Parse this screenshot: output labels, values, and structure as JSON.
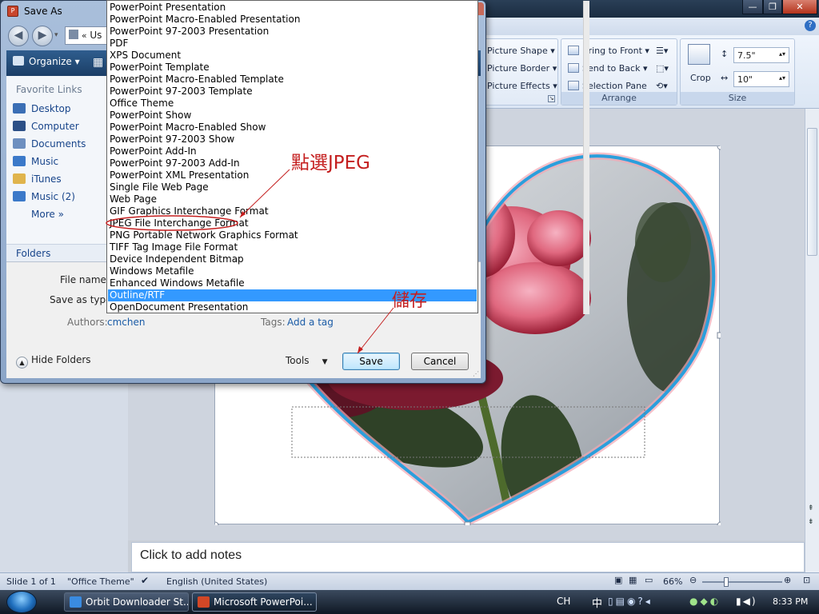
{
  "powerpoint": {
    "picture_tools": {
      "picture_shape": "Picture Shape",
      "picture_border": "Picture Border",
      "picture_effects": "Picture Effects"
    },
    "arrange": {
      "bring_to_front": "Bring to Front",
      "send_to_back": "Send to Back",
      "selection_pane": "Selection Pane",
      "group_label": "Arrange"
    },
    "size": {
      "crop": "Crop",
      "height": "7.5\"",
      "width": "10\"",
      "group_label": "Size"
    },
    "notes_placeholder": "Click to add notes",
    "status": {
      "slide": "Slide 1 of 1",
      "theme": "\"Office Theme\"",
      "language": "English (United States)",
      "zoom": "66%"
    }
  },
  "dialog": {
    "title": "Save As",
    "address_text": "Us",
    "organize": "Organize",
    "favorite_links_header": "Favorite Links",
    "favorites": [
      {
        "label": "Desktop",
        "color": "#3b6fb5"
      },
      {
        "label": "Computer",
        "color": "#2b4f86"
      },
      {
        "label": "Documents",
        "color": "#6d8fc0"
      },
      {
        "label": "Music",
        "color": "#3b79c9"
      },
      {
        "label": "iTunes",
        "color": "#e0b44c"
      },
      {
        "label": "Music (2)",
        "color": "#3b79c9"
      },
      {
        "label": "More",
        "color": "none"
      }
    ],
    "more_chevron": "»",
    "folders_label": "Folders",
    "file_name_label": "File name:",
    "save_as_type_label": "Save as type:",
    "authors_label": "Authors:",
    "authors_value": "cmchen",
    "tags_label": "Tags:",
    "tags_value": "Add a tag",
    "hide_folders": "Hide Folders",
    "tools": "Tools",
    "save": "Save",
    "cancel": "Cancel"
  },
  "file_types": [
    "PowerPoint Presentation",
    "PowerPoint Macro-Enabled Presentation",
    "PowerPoint 97-2003 Presentation",
    "PDF",
    "XPS Document",
    "PowerPoint Template",
    "PowerPoint Macro-Enabled Template",
    "PowerPoint 97-2003 Template",
    "Office Theme",
    "PowerPoint Show",
    "PowerPoint Macro-Enabled Show",
    "PowerPoint 97-2003 Show",
    "PowerPoint Add-In",
    "PowerPoint 97-2003 Add-In",
    "PowerPoint XML Presentation",
    "Single File Web Page",
    "Web Page",
    "GIF Graphics Interchange Format",
    "JPEG File Interchange Format",
    "PNG Portable Network Graphics Format",
    "TIFF Tag Image File Format",
    "Device Independent Bitmap",
    "Windows Metafile",
    "Enhanced Windows Metafile",
    "Outline/RTF",
    "OpenDocument Presentation"
  ],
  "selected_file_type_index": 24,
  "annotations": {
    "select_jpeg": "點選JPEG",
    "save_note": "儲存"
  },
  "taskbar": {
    "tasks": [
      {
        "label": "Orbit Downloader St...",
        "active": false
      },
      {
        "label": "Microsoft PowerPoi...",
        "active": true
      }
    ],
    "lang": "CH",
    "ime": "中",
    "clock": "8:33 PM"
  }
}
